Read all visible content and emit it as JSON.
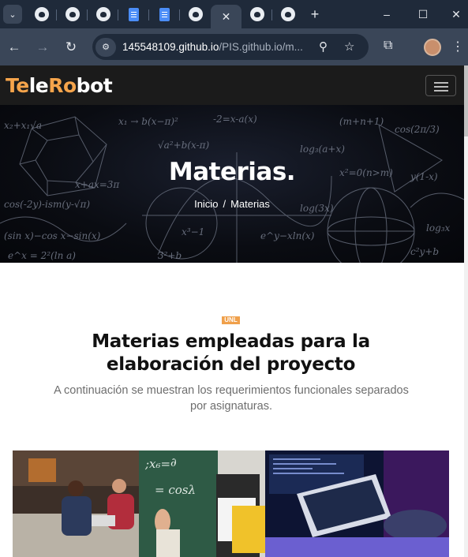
{
  "browser": {
    "tabs": [
      {
        "icon": "github-icon"
      },
      {
        "icon": "github-icon"
      },
      {
        "icon": "github-icon"
      },
      {
        "icon": "docs-icon"
      },
      {
        "icon": "docs-icon"
      },
      {
        "icon": "github-icon"
      },
      {
        "icon": "github-icon",
        "active": true
      },
      {
        "icon": "github-icon"
      },
      {
        "icon": "github-icon"
      }
    ],
    "new_tab": "+",
    "window_controls": {
      "minimize": "–",
      "maximize": "☐",
      "close": "✕"
    },
    "url_host": "145548109.github.io",
    "url_path": "/PIS.github.io/m..."
  },
  "site": {
    "logo_parts": [
      "Te",
      "le",
      "Ro",
      "bot"
    ],
    "accent_color": "#f5a44b"
  },
  "hero": {
    "title": "Materias.",
    "breadcrumb": [
      "Inicio",
      "/",
      "Materias"
    ]
  },
  "section": {
    "badge": "UNL",
    "title": "Materias empleadas para la elaboración del proyecto",
    "subtitle": "A continuación se muestran los requerimientos funcionales separados por asignaturas."
  }
}
